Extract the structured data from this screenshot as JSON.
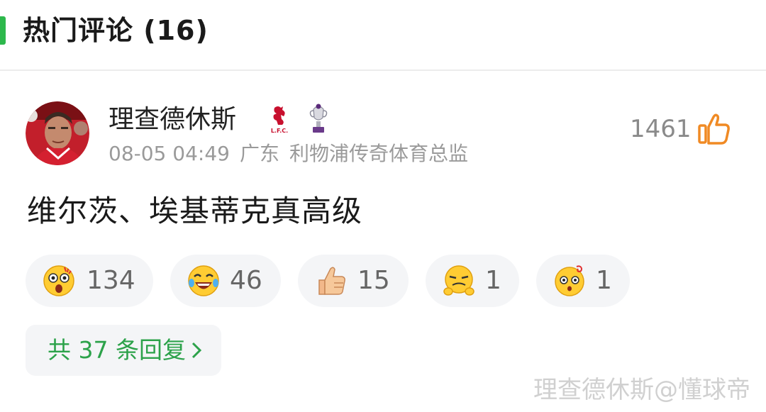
{
  "section": {
    "title": "热门评论 (16)",
    "accent_color": "#2db84c"
  },
  "comment": {
    "avatar_icon": "user-avatar-photo",
    "username": "理查德休斯",
    "badges": [
      "liverpool-fc-crest-icon",
      "premier-league-trophy-icon"
    ],
    "timestamp": "08-05 04:49",
    "location": "广东",
    "user_title": "利物浦传奇体育总监",
    "like_count": "1461",
    "like_icon": "thumbs-up-outline-icon",
    "like_color": "#f08a24",
    "text": "维尔茨、埃基蒂克真高级",
    "reactions": [
      {
        "icon": "shocked-face-emoji",
        "count": "134"
      },
      {
        "icon": "laughing-tears-emoji",
        "count": "46"
      },
      {
        "icon": "thumbs-up-emoji",
        "count": "15"
      },
      {
        "icon": "smirk-face-emoji",
        "count": "1"
      },
      {
        "icon": "dizzy-face-emoji",
        "count": "1"
      }
    ],
    "replies_label": "共 37 条回复",
    "replies_color": "#2ca24a"
  },
  "watermark": "理查德休斯@懂球帝"
}
